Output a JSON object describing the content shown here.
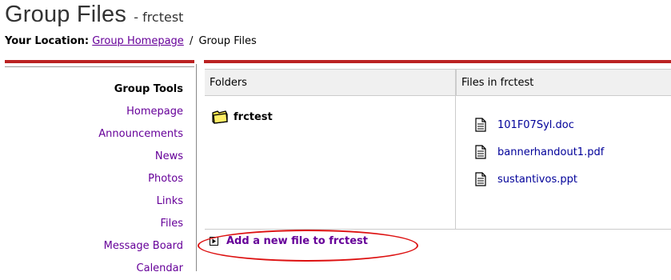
{
  "header": {
    "title": "Group Files",
    "dash": "-",
    "subtitle": "frctest"
  },
  "breadcrumb": {
    "label": "Your Location:",
    "home_link": "Group Homepage",
    "separator": "/",
    "current": "Group Files"
  },
  "sidebar": {
    "heading": "Group Tools",
    "items": [
      {
        "label": "Homepage"
      },
      {
        "label": "Announcements"
      },
      {
        "label": "News"
      },
      {
        "label": "Photos"
      },
      {
        "label": "Links"
      },
      {
        "label": "Files"
      },
      {
        "label": "Message Board"
      },
      {
        "label": "Calendar"
      }
    ]
  },
  "folders": {
    "header": "Folders",
    "items": [
      {
        "name": "frctest",
        "icon": "folder-icon"
      }
    ]
  },
  "files": {
    "header": "Files in frctest",
    "items": [
      {
        "name": "101F07Syl.doc",
        "icon": "document-icon"
      },
      {
        "name": "bannerhandout1.pdf",
        "icon": "document-icon"
      },
      {
        "name": "sustantivos.ppt",
        "icon": "document-icon"
      }
    ]
  },
  "actions": {
    "add_file": "Add a new file to frctest"
  },
  "colors": {
    "accent_red": "#bb2222",
    "link_purple": "#660099",
    "link_blue": "#000099",
    "highlight_oval": "#dd1111"
  }
}
